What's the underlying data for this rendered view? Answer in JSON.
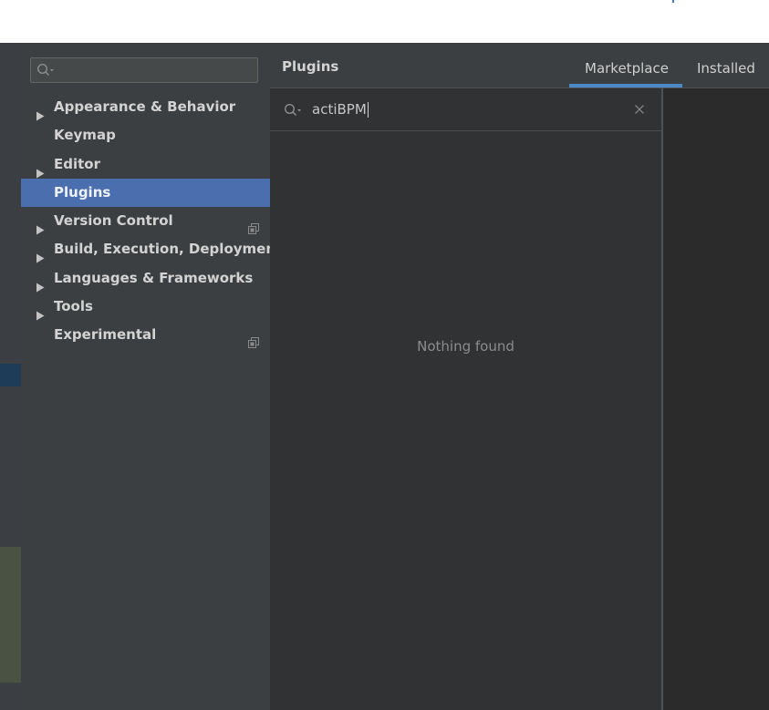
{
  "sidebar": {
    "search_placeholder": "",
    "items": [
      {
        "label": "Appearance & Behavior",
        "expandable": true,
        "selected": false,
        "has_copy_icon": false
      },
      {
        "label": "Keymap",
        "expandable": false,
        "selected": false,
        "has_copy_icon": false
      },
      {
        "label": "Editor",
        "expandable": true,
        "selected": false,
        "has_copy_icon": false
      },
      {
        "label": "Plugins",
        "expandable": false,
        "selected": true,
        "has_copy_icon": false
      },
      {
        "label": "Version Control",
        "expandable": true,
        "selected": false,
        "has_copy_icon": true
      },
      {
        "label": "Build, Execution, Deployment",
        "expandable": true,
        "selected": false,
        "has_copy_icon": false
      },
      {
        "label": "Languages & Frameworks",
        "expandable": true,
        "selected": false,
        "has_copy_icon": false
      },
      {
        "label": "Tools",
        "expandable": true,
        "selected": false,
        "has_copy_icon": false
      },
      {
        "label": "Experimental",
        "expandable": false,
        "selected": false,
        "has_copy_icon": true
      }
    ]
  },
  "header": {
    "title": "Plugins",
    "tabs": [
      {
        "label": "Marketplace",
        "active": true
      },
      {
        "label": "Installed",
        "active": false
      }
    ]
  },
  "search": {
    "value": "actiBPM"
  },
  "results": {
    "empty_text": "Nothing found"
  },
  "colors": {
    "selection": "#4b6eaf",
    "tab_underline": "#4a88c7",
    "panel": "#3c3f41",
    "editor_bg": "#2b2b2b"
  }
}
